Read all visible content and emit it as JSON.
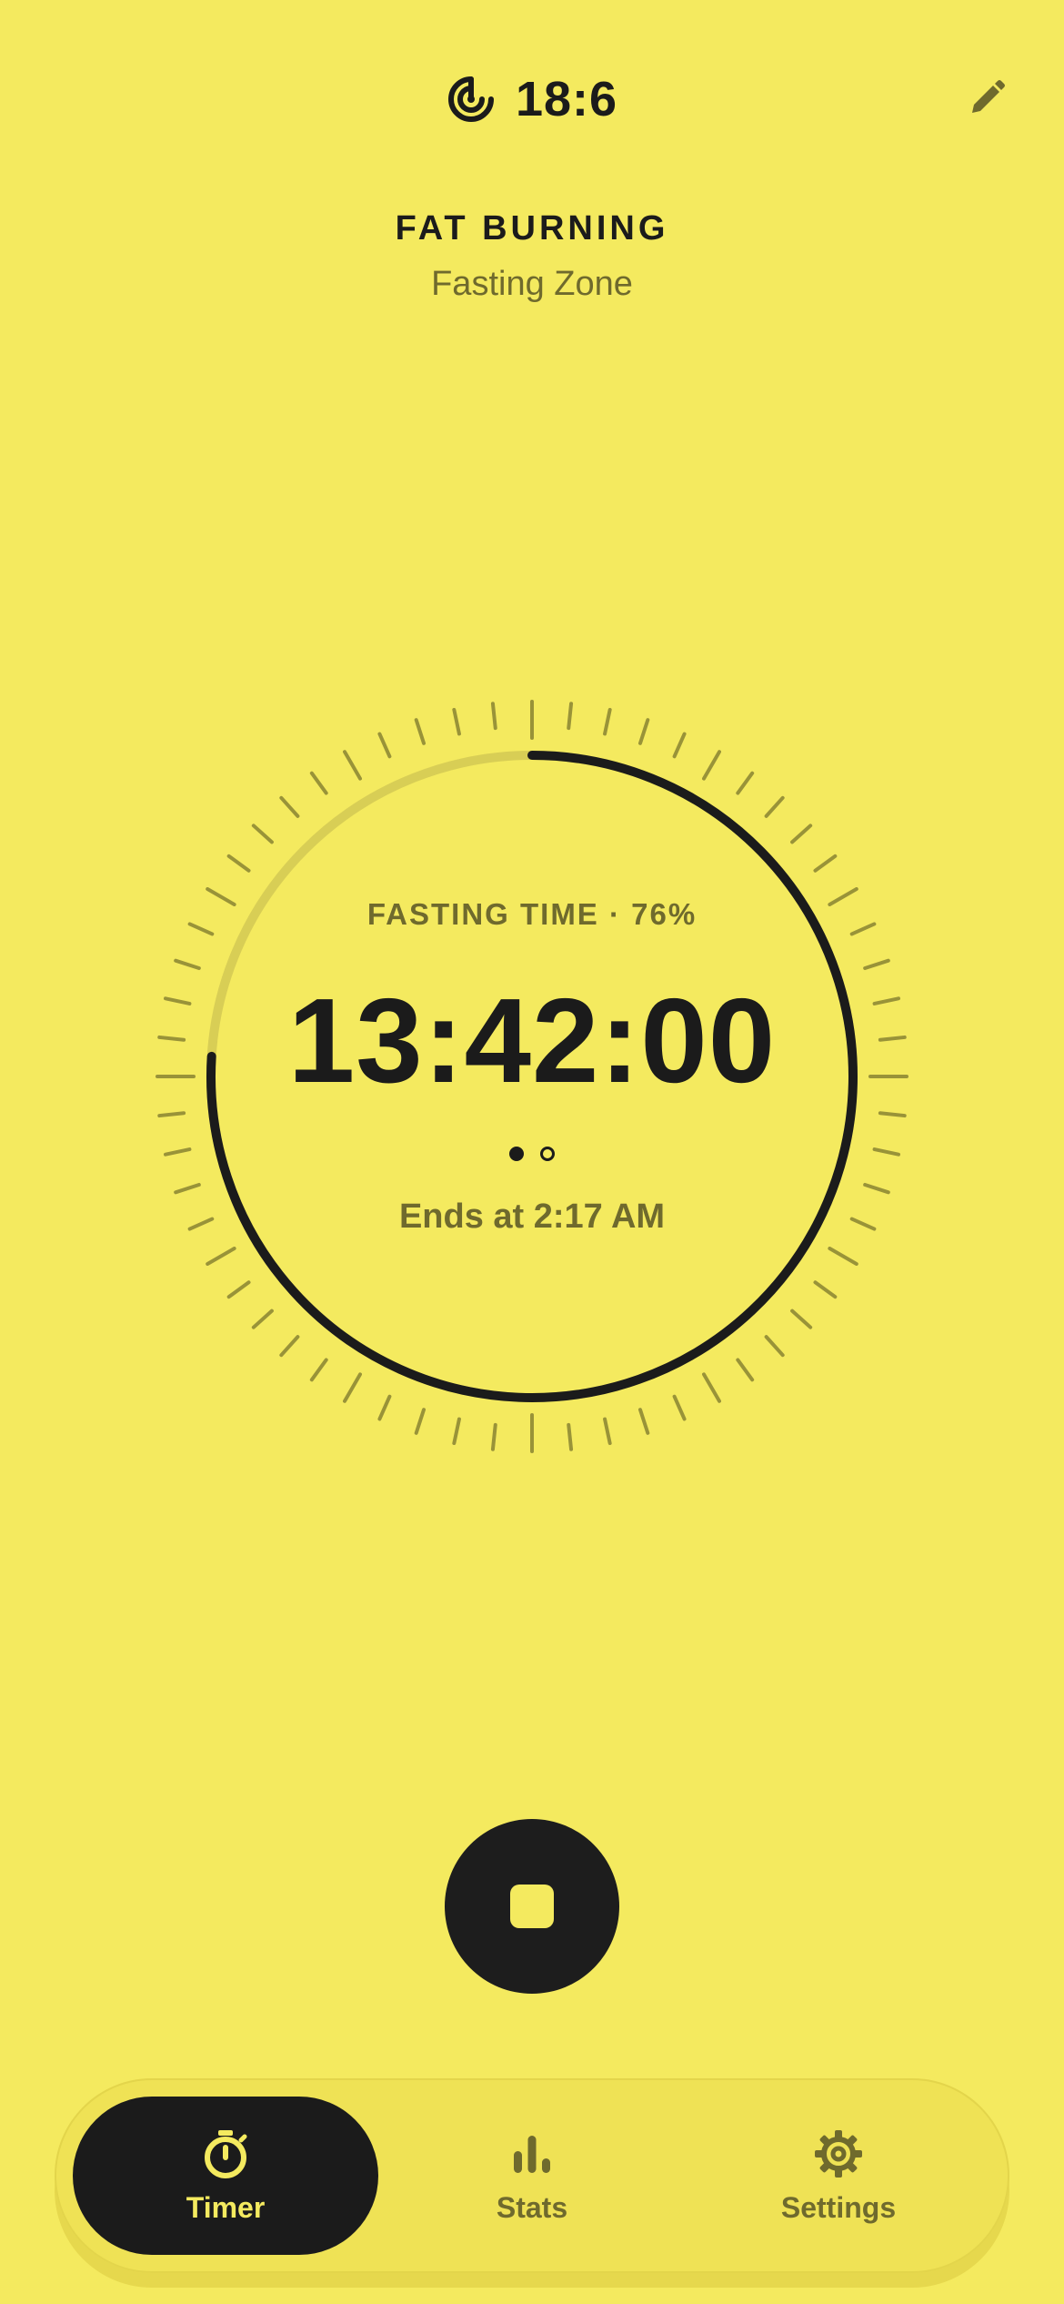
{
  "header": {
    "plan_icon": "fasting-target-icon",
    "plan_label": "18:6",
    "edit_icon": "pencil-icon"
  },
  "zone": {
    "title": "FAT BURNING",
    "subtitle": "Fasting Zone"
  },
  "timer": {
    "label": "FASTING TIME · 76%",
    "elapsed": "13:42:00",
    "progress_fraction": 0.76,
    "ends_at": "Ends at 2:17 AM",
    "pages": 2,
    "active_page": 0
  },
  "controls": {
    "stop_icon": "stop-icon"
  },
  "nav": {
    "items": [
      {
        "label": "Timer",
        "icon": "stopwatch-icon",
        "active": true
      },
      {
        "label": "Stats",
        "icon": "bar-chart-icon",
        "active": false
      },
      {
        "label": "Settings",
        "icon": "gear-icon",
        "active": false
      }
    ]
  },
  "colors": {
    "background": "#F4EA5F",
    "ink": "#1B1B1B",
    "muted": "#6F6A2D",
    "track": "#D8CE55"
  }
}
